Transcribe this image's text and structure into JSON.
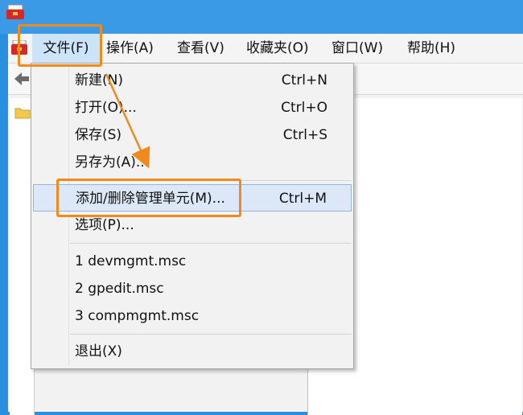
{
  "menubar": {
    "items": [
      {
        "label": "文件(F)"
      },
      {
        "label": "操作(A)"
      },
      {
        "label": "查看(V)"
      },
      {
        "label": "收藏夹(O)"
      },
      {
        "label": "窗口(W)"
      },
      {
        "label": "帮助(H)"
      }
    ]
  },
  "file_menu": {
    "new": {
      "label": "新建(N)",
      "shortcut": "Ctrl+N"
    },
    "open": {
      "label": "打开(O)...",
      "shortcut": "Ctrl+O"
    },
    "save": {
      "label": "保存(S)",
      "shortcut": "Ctrl+S"
    },
    "save_as": {
      "label": "另存为(A)..."
    },
    "add_remove_snapin": {
      "label": "添加/删除管理单元(M)...",
      "shortcut": "Ctrl+M"
    },
    "options": {
      "label": "选项(P)..."
    },
    "recent": [
      {
        "label": "1 devmgmt.msc"
      },
      {
        "label": "2 gpedit.msc"
      },
      {
        "label": "3 compmgmt.msc"
      }
    ],
    "exit": {
      "label": "退出(X)"
    }
  },
  "colors": {
    "annotation": "#f08a1c",
    "highlight": "#dce8f7",
    "window_accent": "#3a9ae6"
  },
  "icons": {
    "app": "mmc-toolbox-icon",
    "back": "back-arrow-icon",
    "folder": "folder-icon"
  }
}
